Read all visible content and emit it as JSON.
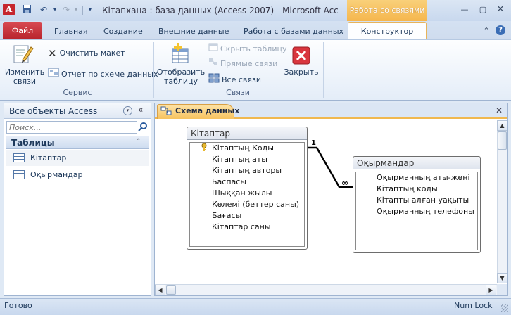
{
  "window": {
    "title": "Кітапхана : база данных (Access 2007)  -  Microsoft Acc...",
    "contextual_header": "Работа со связями",
    "app_icon_letter": "A"
  },
  "tabs": [
    "Файл",
    "Главная",
    "Создание",
    "Внешние данные",
    "Работа с базами данных",
    "Конструктор"
  ],
  "ribbon": {
    "groups": {
      "service": {
        "label": "Сервис",
        "edit_relations": "Изменить\nсвязи",
        "clear_layout": "Очистить макет",
        "relations_report": "Отчет по схеме данных"
      },
      "relations": {
        "label": "Связи",
        "show_table": "Отобразить\nтаблицу",
        "hide_table": "Скрыть таблицу",
        "direct_relations": "Прямые связи",
        "all_relations": "Все связи",
        "close": "Закрыть"
      }
    }
  },
  "navpane": {
    "title": "Все объекты Access",
    "search_placeholder": "Поиск...",
    "group_title": "Таблицы",
    "items": [
      "Кітаптар",
      "Оқырмандар"
    ]
  },
  "document": {
    "tab_label": "Схема данных",
    "tables": [
      {
        "name": "Кітаптар",
        "fields": [
          "Кітаптың Коды",
          "Кітаптың аты",
          "Кітаптың авторы",
          "Баспасы",
          "Шыққан жылы",
          "Көлемі (беттер саны)",
          "Бағасы",
          "Кітаптар саны"
        ],
        "key_field_index": 0
      },
      {
        "name": "Оқырмандар",
        "fields": [
          "Оқырманның аты-жөні",
          "Кітаптың коды",
          "Кітапты алған уақыты",
          "Оқырманның телефоны"
        ]
      }
    ],
    "relationship": {
      "from_label": "1",
      "to_label": "∞"
    }
  },
  "statusbar": {
    "left": "Готово",
    "right": "Num Lock"
  }
}
